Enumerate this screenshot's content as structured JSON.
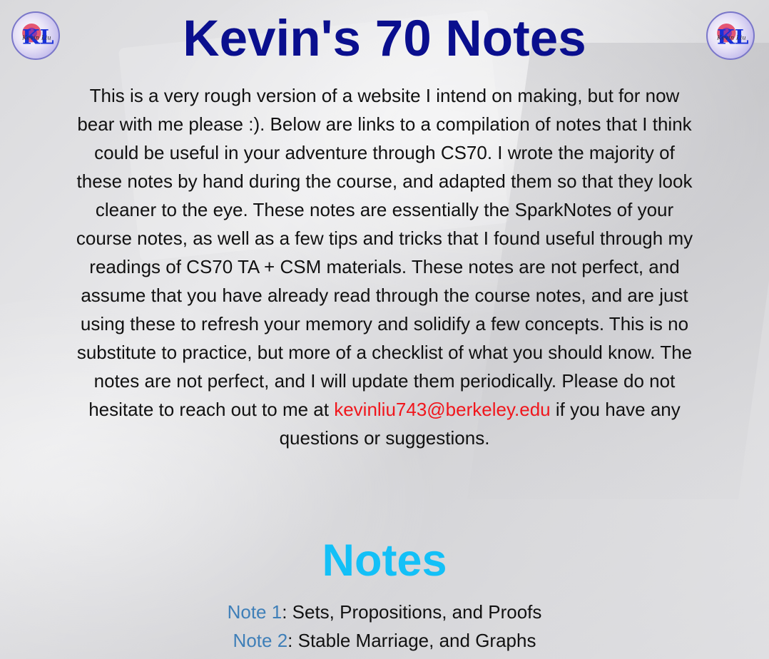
{
  "header": {
    "title": "Kevin's 70 Notes",
    "logo_text": "KL",
    "logo_script": "Kevin Liu"
  },
  "intro": {
    "text_before_email": "This is a very rough version of a website I intend on making, but for now bear with me please :). Below are links to a compilation of notes that I think could be useful in your adventure through CS70. I wrote the majority of these notes by hand during the course, and adapted them so that they look cleaner to the eye. These notes are essentially the SparkNotes of your course notes, as well as a few tips and tricks that I found useful through my readings of CS70 TA + CSM materials. These notes are not perfect, and assume that you have already read through the course notes, and are just using these to refresh your memory and solidify a few concepts. This is no substitute to practice, but more of a checklist of what you should know. The notes are not perfect, and I will update them periodically. Please do not hesitate to reach out to me at ",
    "email": "kevinliu743@berkeley.edu",
    "text_after_email": " if you have any questions or suggestions."
  },
  "notes": {
    "heading": "Notes",
    "items": [
      {
        "link": "Note 1",
        "description": ": Sets, Propositions, and Proofs"
      },
      {
        "link": "Note 2",
        "description": ": Stable Marriage, and Graphs"
      }
    ]
  },
  "colors": {
    "title": "#0a0f8e",
    "notes_heading": "#13c0f7",
    "email_link": "#f0161c",
    "note_link": "#3f7fb8",
    "body_text": "#111111"
  }
}
